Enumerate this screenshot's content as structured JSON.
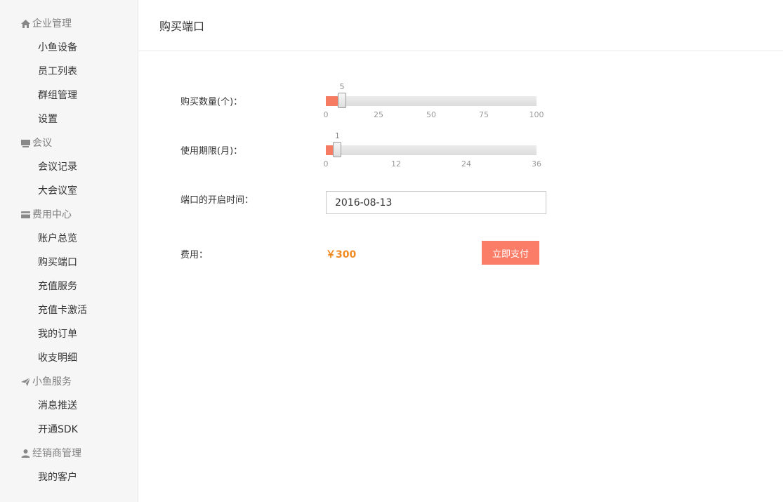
{
  "sidebar": {
    "groups": [
      {
        "title": "企业管理",
        "icon": "home-icon",
        "items": [
          {
            "label": "小鱼设备"
          },
          {
            "label": "员工列表"
          },
          {
            "label": "群组管理"
          },
          {
            "label": "设置"
          }
        ]
      },
      {
        "title": "会议",
        "icon": "monitor-icon",
        "items": [
          {
            "label": "会议记录"
          },
          {
            "label": "大会议室"
          }
        ]
      },
      {
        "title": "费用中心",
        "icon": "credit-card-icon",
        "items": [
          {
            "label": "账户总览"
          },
          {
            "label": "购买端口"
          },
          {
            "label": "充值服务"
          },
          {
            "label": "充值卡激活"
          },
          {
            "label": "我的订单"
          },
          {
            "label": "收支明细"
          }
        ]
      },
      {
        "title": "小鱼服务",
        "icon": "paper-plane-icon",
        "items": [
          {
            "label": "消息推送"
          },
          {
            "label": "开通SDK"
          }
        ]
      },
      {
        "title": "经销商管理",
        "icon": "user-icon",
        "items": [
          {
            "label": "我的客户"
          }
        ]
      }
    ]
  },
  "main": {
    "title": "购买端口",
    "form": {
      "quantity": {
        "label": "购买数量(个)：",
        "value": 5,
        "value_label": "5",
        "min": 0,
        "max": 100,
        "ticks": [
          "0",
          "25",
          "50",
          "75",
          "100"
        ]
      },
      "period": {
        "label": "使用期限(月)：",
        "value": 1,
        "value_label": "1",
        "min": 0,
        "max": 36,
        "ticks": [
          "0",
          "12",
          "24",
          "36"
        ]
      },
      "start_date": {
        "label": "端口的开启时间：",
        "value": "2016-08-13"
      },
      "fee": {
        "label": "费用：",
        "amount": "￥300"
      },
      "pay_button_label": "立即支付"
    }
  },
  "colors": {
    "accent": "#fb7d68",
    "price": "#f08a24",
    "sidebar_bg": "#f6f6f6"
  }
}
